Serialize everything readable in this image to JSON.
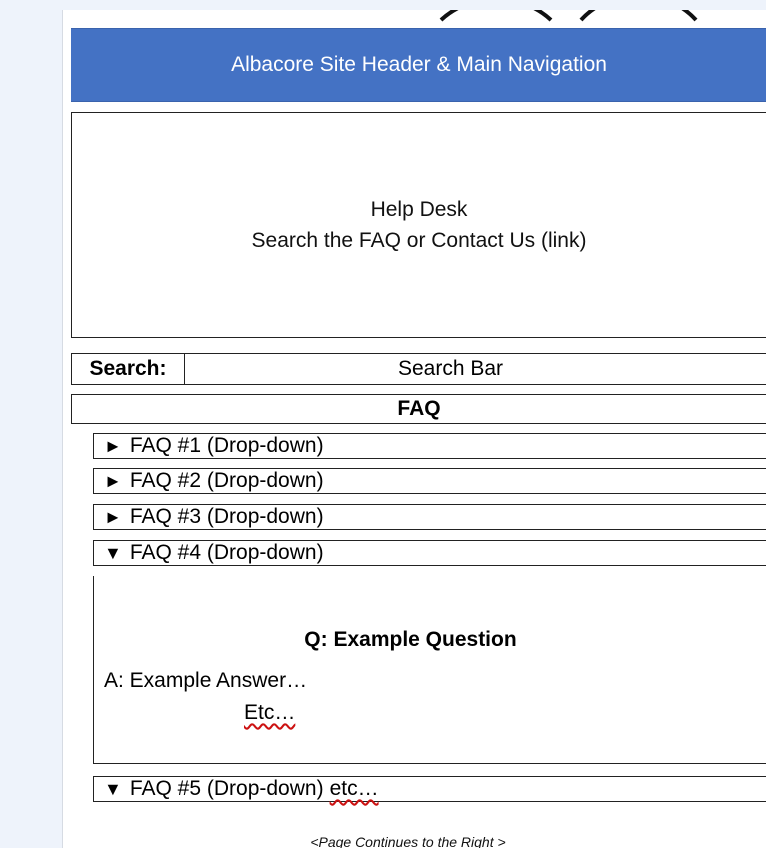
{
  "header": {
    "title": "Albacore Site Header & Main Navigation"
  },
  "help_box": {
    "title": "Help Desk",
    "subtitle": "Search the FAQ or Contact Us (link)"
  },
  "search": {
    "label": "Search:",
    "bar_text": "Search Bar"
  },
  "faq": {
    "title": "FAQ",
    "items": [
      {
        "arrow": "►",
        "label": "FAQ #1 (Drop-down)"
      },
      {
        "arrow": "►",
        "label": "FAQ #2 (Drop-down)"
      },
      {
        "arrow": "►",
        "label": "FAQ #3 (Drop-down)"
      },
      {
        "arrow": "▼",
        "label": "FAQ #4 (Drop-down)"
      }
    ],
    "expanded": {
      "question": "Q: Example Question",
      "answer": "A: Example Answer…",
      "etc": "Etc…"
    },
    "item5": {
      "arrow": "▼",
      "label": "FAQ #5 (Drop-down)",
      "suffix": "etc…"
    }
  },
  "footer": {
    "note": "<Page Continues to the Right >"
  }
}
